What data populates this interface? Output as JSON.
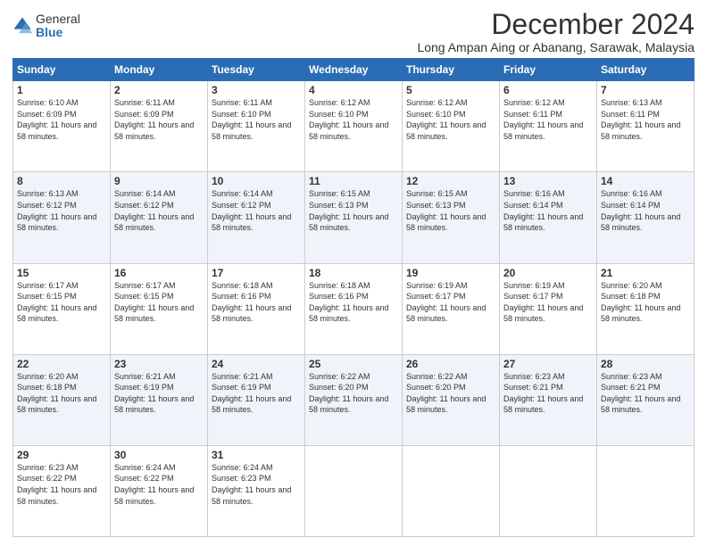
{
  "logo": {
    "general": "General",
    "blue": "Blue"
  },
  "header": {
    "month_title": "December 2024",
    "location": "Long Ampan Aing or Abanang, Sarawak, Malaysia"
  },
  "weekdays": [
    "Sunday",
    "Monday",
    "Tuesday",
    "Wednesday",
    "Thursday",
    "Friday",
    "Saturday"
  ],
  "weeks": [
    [
      {
        "day": "1",
        "sunrise": "6:10 AM",
        "sunset": "6:09 PM",
        "daylight": "11 hours and 58 minutes."
      },
      {
        "day": "2",
        "sunrise": "6:11 AM",
        "sunset": "6:09 PM",
        "daylight": "11 hours and 58 minutes."
      },
      {
        "day": "3",
        "sunrise": "6:11 AM",
        "sunset": "6:10 PM",
        "daylight": "11 hours and 58 minutes."
      },
      {
        "day": "4",
        "sunrise": "6:12 AM",
        "sunset": "6:10 PM",
        "daylight": "11 hours and 58 minutes."
      },
      {
        "day": "5",
        "sunrise": "6:12 AM",
        "sunset": "6:10 PM",
        "daylight": "11 hours and 58 minutes."
      },
      {
        "day": "6",
        "sunrise": "6:12 AM",
        "sunset": "6:11 PM",
        "daylight": "11 hours and 58 minutes."
      },
      {
        "day": "7",
        "sunrise": "6:13 AM",
        "sunset": "6:11 PM",
        "daylight": "11 hours and 58 minutes."
      }
    ],
    [
      {
        "day": "8",
        "sunrise": "6:13 AM",
        "sunset": "6:12 PM",
        "daylight": "11 hours and 58 minutes."
      },
      {
        "day": "9",
        "sunrise": "6:14 AM",
        "sunset": "6:12 PM",
        "daylight": "11 hours and 58 minutes."
      },
      {
        "day": "10",
        "sunrise": "6:14 AM",
        "sunset": "6:12 PM",
        "daylight": "11 hours and 58 minutes."
      },
      {
        "day": "11",
        "sunrise": "6:15 AM",
        "sunset": "6:13 PM",
        "daylight": "11 hours and 58 minutes."
      },
      {
        "day": "12",
        "sunrise": "6:15 AM",
        "sunset": "6:13 PM",
        "daylight": "11 hours and 58 minutes."
      },
      {
        "day": "13",
        "sunrise": "6:16 AM",
        "sunset": "6:14 PM",
        "daylight": "11 hours and 58 minutes."
      },
      {
        "day": "14",
        "sunrise": "6:16 AM",
        "sunset": "6:14 PM",
        "daylight": "11 hours and 58 minutes."
      }
    ],
    [
      {
        "day": "15",
        "sunrise": "6:17 AM",
        "sunset": "6:15 PM",
        "daylight": "11 hours and 58 minutes."
      },
      {
        "day": "16",
        "sunrise": "6:17 AM",
        "sunset": "6:15 PM",
        "daylight": "11 hours and 58 minutes."
      },
      {
        "day": "17",
        "sunrise": "6:18 AM",
        "sunset": "6:16 PM",
        "daylight": "11 hours and 58 minutes."
      },
      {
        "day": "18",
        "sunrise": "6:18 AM",
        "sunset": "6:16 PM",
        "daylight": "11 hours and 58 minutes."
      },
      {
        "day": "19",
        "sunrise": "6:19 AM",
        "sunset": "6:17 PM",
        "daylight": "11 hours and 58 minutes."
      },
      {
        "day": "20",
        "sunrise": "6:19 AM",
        "sunset": "6:17 PM",
        "daylight": "11 hours and 58 minutes."
      },
      {
        "day": "21",
        "sunrise": "6:20 AM",
        "sunset": "6:18 PM",
        "daylight": "11 hours and 58 minutes."
      }
    ],
    [
      {
        "day": "22",
        "sunrise": "6:20 AM",
        "sunset": "6:18 PM",
        "daylight": "11 hours and 58 minutes."
      },
      {
        "day": "23",
        "sunrise": "6:21 AM",
        "sunset": "6:19 PM",
        "daylight": "11 hours and 58 minutes."
      },
      {
        "day": "24",
        "sunrise": "6:21 AM",
        "sunset": "6:19 PM",
        "daylight": "11 hours and 58 minutes."
      },
      {
        "day": "25",
        "sunrise": "6:22 AM",
        "sunset": "6:20 PM",
        "daylight": "11 hours and 58 minutes."
      },
      {
        "day": "26",
        "sunrise": "6:22 AM",
        "sunset": "6:20 PM",
        "daylight": "11 hours and 58 minutes."
      },
      {
        "day": "27",
        "sunrise": "6:23 AM",
        "sunset": "6:21 PM",
        "daylight": "11 hours and 58 minutes."
      },
      {
        "day": "28",
        "sunrise": "6:23 AM",
        "sunset": "6:21 PM",
        "daylight": "11 hours and 58 minutes."
      }
    ],
    [
      {
        "day": "29",
        "sunrise": "6:23 AM",
        "sunset": "6:22 PM",
        "daylight": "11 hours and 58 minutes."
      },
      {
        "day": "30",
        "sunrise": "6:24 AM",
        "sunset": "6:22 PM",
        "daylight": "11 hours and 58 minutes."
      },
      {
        "day": "31",
        "sunrise": "6:24 AM",
        "sunset": "6:23 PM",
        "daylight": "11 hours and 58 minutes."
      },
      null,
      null,
      null,
      null
    ]
  ]
}
